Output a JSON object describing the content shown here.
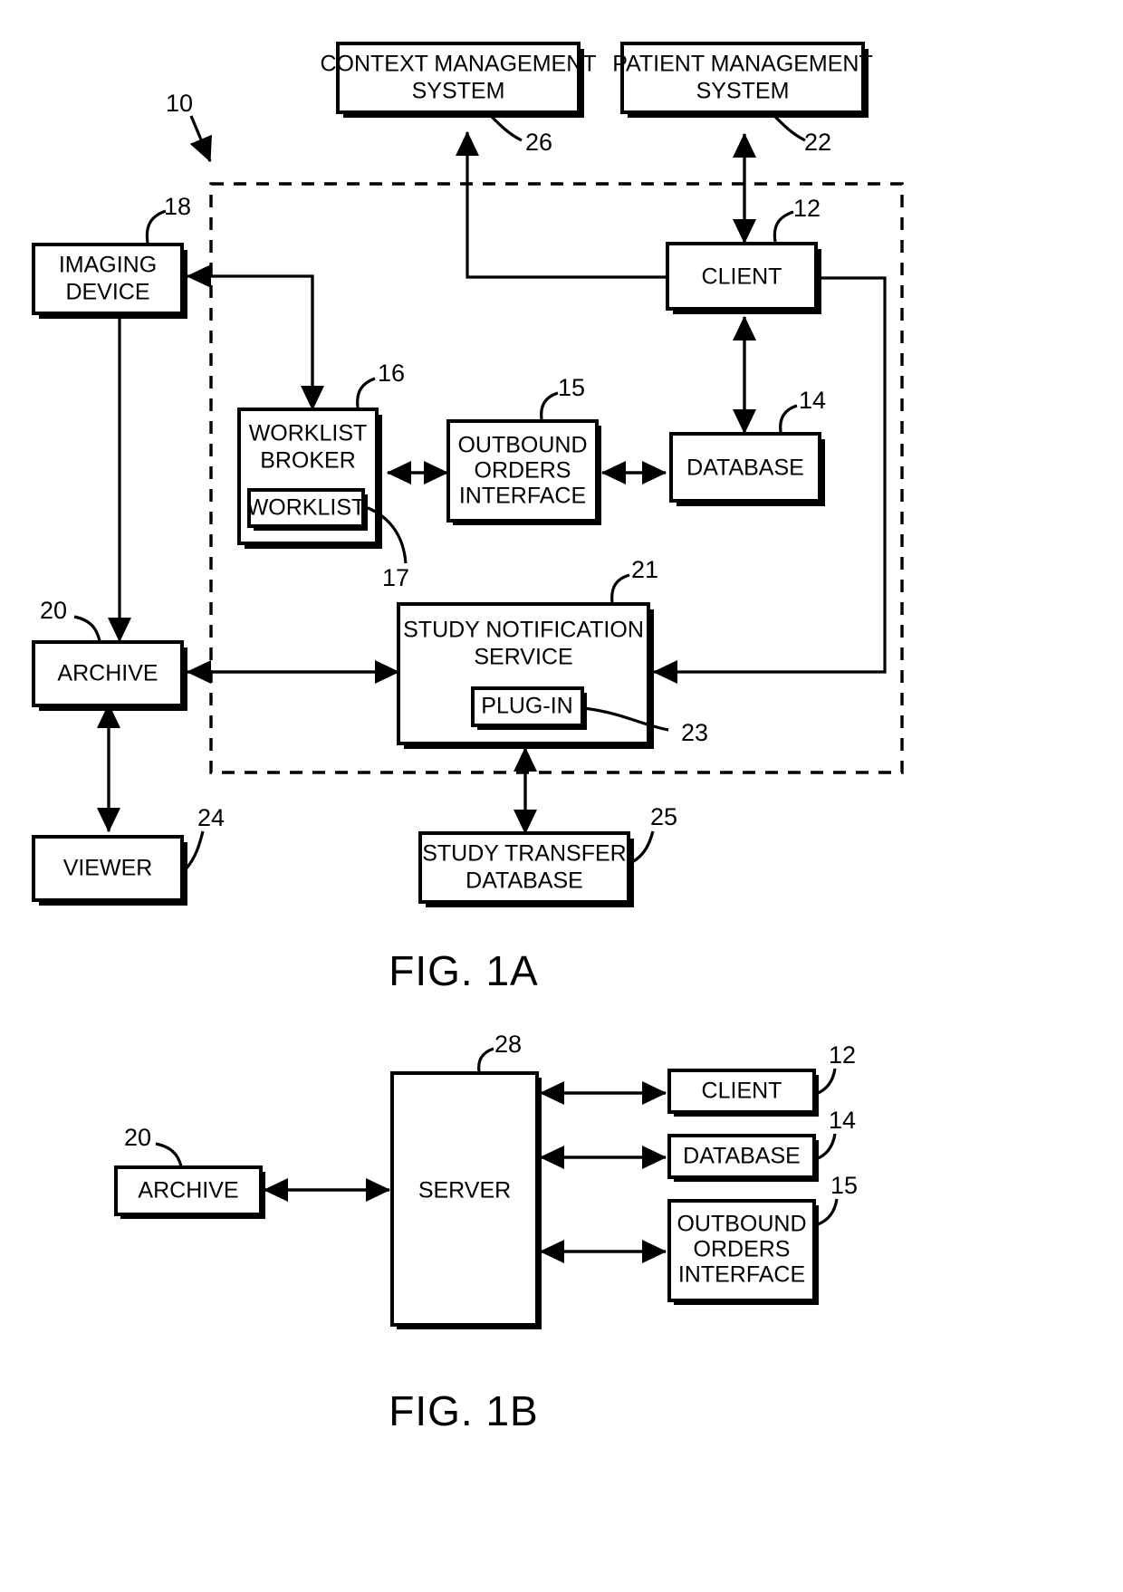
{
  "document": {
    "type": "patent-figure-sheet",
    "figures": [
      {
        "id": "fig-1a",
        "caption": "FIG. 1A"
      },
      {
        "id": "fig-1b",
        "caption": "FIG. 1B"
      }
    ]
  },
  "fig1a": {
    "caption": "FIG. 1A",
    "system_ref": "10",
    "boundary": {
      "style": "dashed",
      "label": "system-boundary"
    },
    "blocks": [
      {
        "key": "context_management_system",
        "lines": [
          "CONTEXT MANAGEMENT",
          "SYSTEM"
        ],
        "ref": "26"
      },
      {
        "key": "patient_management_system",
        "lines": [
          "PATIENT MANAGEMENT",
          "SYSTEM"
        ],
        "ref": "22"
      },
      {
        "key": "imaging_device",
        "lines": [
          "IMAGING",
          "DEVICE"
        ],
        "ref": "18"
      },
      {
        "key": "client",
        "lines": [
          "CLIENT"
        ],
        "ref": "12"
      },
      {
        "key": "worklist_broker",
        "lines": [
          "WORKLIST",
          "BROKER"
        ],
        "ref": "16"
      },
      {
        "key": "worklist",
        "lines": [
          "WORKLIST"
        ],
        "ref": "17"
      },
      {
        "key": "outbound_orders_interface",
        "lines": [
          "OUTBOUND",
          "ORDERS",
          "INTERFACE"
        ],
        "ref": "15"
      },
      {
        "key": "database",
        "lines": [
          "DATABASE"
        ],
        "ref": "14"
      },
      {
        "key": "archive",
        "lines": [
          "ARCHIVE"
        ],
        "ref": "20"
      },
      {
        "key": "study_notification_service",
        "lines": [
          "STUDY NOTIFICATION",
          "SERVICE"
        ],
        "ref": "21"
      },
      {
        "key": "plug_in",
        "lines": [
          "PLUG-IN"
        ],
        "ref": "23"
      },
      {
        "key": "viewer",
        "lines": [
          "VIEWER"
        ],
        "ref": "24"
      },
      {
        "key": "study_transfer_database",
        "lines": [
          "STUDY TRANSFER",
          "DATABASE"
        ],
        "ref": "25"
      }
    ],
    "connections": [
      {
        "from": "client",
        "to": "context_management_system",
        "arrows": "one-way"
      },
      {
        "from": "client",
        "to": "patient_management_system",
        "arrows": "two-way"
      },
      {
        "from": "worklist_broker",
        "to": "imaging_device",
        "arrows": "one-way"
      },
      {
        "from": "imaging_device",
        "to": "worklist_broker",
        "arrows": "one-way"
      },
      {
        "from": "worklist_broker",
        "to": "outbound_orders_interface",
        "arrows": "two-way"
      },
      {
        "from": "outbound_orders_interface",
        "to": "database",
        "arrows": "two-way"
      },
      {
        "from": "database",
        "to": "client",
        "arrows": "two-way"
      },
      {
        "from": "imaging_device",
        "to": "archive",
        "arrows": "one-way"
      },
      {
        "from": "archive",
        "to": "study_notification_service",
        "arrows": "two-way"
      },
      {
        "from": "client",
        "to": "study_notification_service",
        "arrows": "one-way"
      },
      {
        "from": "archive",
        "to": "viewer",
        "arrows": "two-way"
      },
      {
        "from": "study_transfer_database",
        "to": "study_notification_service",
        "arrows": "two-way"
      }
    ]
  },
  "fig1b": {
    "caption": "FIG. 1B",
    "blocks": [
      {
        "key": "archive",
        "lines": [
          "ARCHIVE"
        ],
        "ref": "20"
      },
      {
        "key": "server",
        "lines": [
          "SERVER"
        ],
        "ref": "28"
      },
      {
        "key": "client",
        "lines": [
          "CLIENT"
        ],
        "ref": "12"
      },
      {
        "key": "database",
        "lines": [
          "DATABASE"
        ],
        "ref": "14"
      },
      {
        "key": "outbound_orders_interface",
        "lines": [
          "OUTBOUND",
          "ORDERS",
          "INTERFACE"
        ],
        "ref": "15"
      }
    ],
    "connections": [
      {
        "from": "archive",
        "to": "server",
        "arrows": "two-way"
      },
      {
        "from": "server",
        "to": "client",
        "arrows": "two-way"
      },
      {
        "from": "server",
        "to": "database",
        "arrows": "two-way"
      },
      {
        "from": "server",
        "to": "outbound_orders_interface",
        "arrows": "two-way"
      }
    ]
  },
  "labels": {
    "n10": "10",
    "n12": "12",
    "n12b": "12",
    "n14": "14",
    "n14b": "14",
    "n15": "15",
    "n15b": "15",
    "n16": "16",
    "n17": "17",
    "n18": "18",
    "n20": "20",
    "n20b": "20",
    "n21": "21",
    "n22": "22",
    "n23": "23",
    "n24": "24",
    "n25": "25",
    "n26": "26",
    "n28": "28"
  },
  "text": {
    "context_management_l1": "CONTEXT MANAGEMENT",
    "context_management_l2": "SYSTEM",
    "patient_management_l1": "PATIENT MANAGEMENT",
    "patient_management_l2": "SYSTEM",
    "imaging_device_l1": "IMAGING",
    "imaging_device_l2": "DEVICE",
    "client": "CLIENT",
    "worklist_broker_l1": "WORKLIST",
    "worklist_broker_l2": "BROKER",
    "worklist": "WORKLIST",
    "outbound_l1": "OUTBOUND",
    "outbound_l2": "ORDERS",
    "outbound_l3": "INTERFACE",
    "database": "DATABASE",
    "archive": "ARCHIVE",
    "sns_l1": "STUDY NOTIFICATION",
    "sns_l2": "SERVICE",
    "plugin": "PLUG-IN",
    "viewer": "VIEWER",
    "std_l1": "STUDY TRANSFER",
    "std_l2": "DATABASE",
    "fig1a": "FIG. 1A",
    "fig1b": "FIG. 1B",
    "server": "SERVER",
    "client_b": "CLIENT",
    "database_b": "DATABASE",
    "archive_b": "ARCHIVE",
    "outbound_b_l1": "OUTBOUND",
    "outbound_b_l2": "ORDERS",
    "outbound_b_l3": "INTERFACE"
  },
  "colors": {
    "ink": "#000000",
    "paper": "#ffffff"
  }
}
